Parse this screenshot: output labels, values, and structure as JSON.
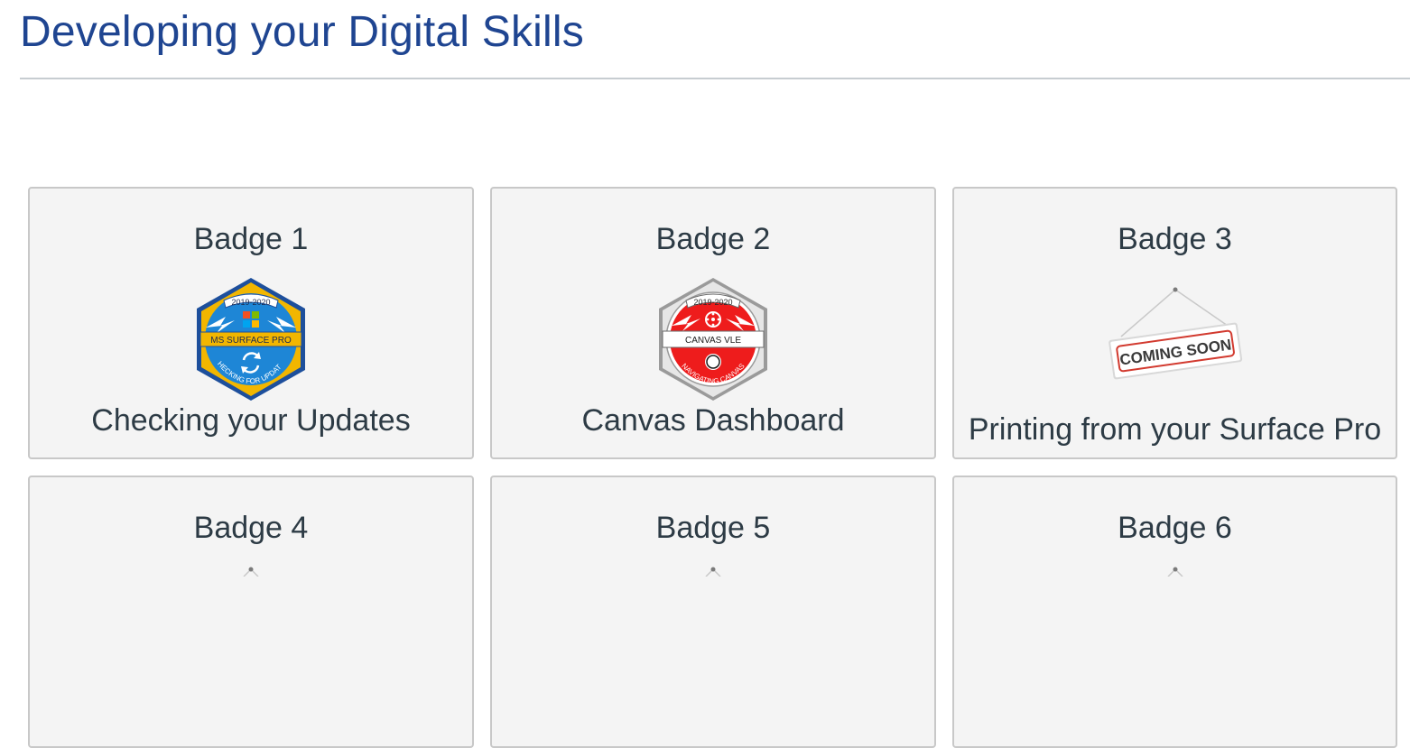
{
  "page": {
    "title": "Developing your Digital Skills"
  },
  "badges": [
    {
      "label": "Badge 1",
      "caption": "Checking your Updates",
      "image": {
        "type": "hex-badge",
        "year": "2019-2020",
        "banner": "MS SURFACE PRO",
        "ring_text": "CHECKING FOR UPDATES",
        "icon": "refresh-icon",
        "logo": "windows-logo-icon",
        "fill": "#f2b600",
        "inner": "#1e86d6"
      }
    },
    {
      "label": "Badge 2",
      "caption": "Canvas Dashboard",
      "image": {
        "type": "hex-badge",
        "year": "2019-2020",
        "banner": "CANVAS VLE",
        "ring_text": "NAVIGATING CANVAS",
        "icon": "compass-icon",
        "logo": "canvas-logo-icon",
        "fill": "#d9d9d9",
        "inner": "#ee1c1c"
      }
    },
    {
      "label": "Badge 3",
      "caption": "Printing from your Surface Pro",
      "image": {
        "type": "coming-soon-sign",
        "sign_text": "COMING SOON"
      }
    },
    {
      "label": "Badge 4",
      "caption": "",
      "image": {
        "type": "coming-soon-sign",
        "sign_text": ""
      }
    },
    {
      "label": "Badge 5",
      "caption": "",
      "image": {
        "type": "coming-soon-sign",
        "sign_text": ""
      }
    },
    {
      "label": "Badge 6",
      "caption": "",
      "image": {
        "type": "coming-soon-sign",
        "sign_text": ""
      }
    }
  ]
}
